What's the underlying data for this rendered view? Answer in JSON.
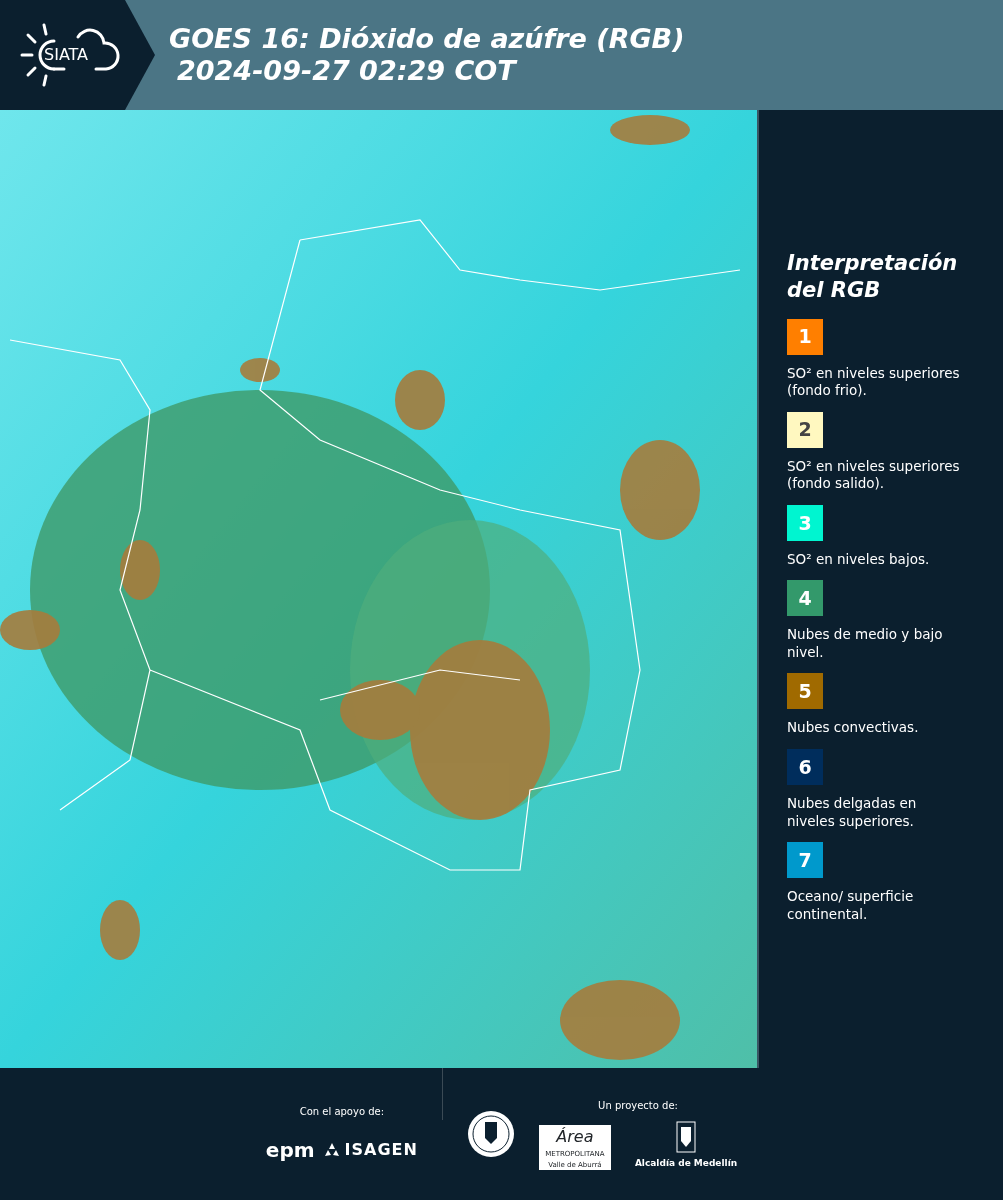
{
  "header": {
    "logo_text": "SIATA",
    "title": "GOES 16: Dióxido de azúfre (RGB)",
    "timestamp": "2024-09-27 02:29 COT"
  },
  "legend": {
    "title_lines": [
      "Interpretación",
      "del RGB"
    ],
    "items": [
      {
        "number": "1",
        "color": "#ff7f00",
        "text": "SO² en niveles superiores (fondo frio)."
      },
      {
        "number": "2",
        "color": "#fff8c0",
        "text": "SO² en niveles superiores (fondo salido)."
      },
      {
        "number": "3",
        "color": "#00f5d0",
        "text": "SO² en niveles bajos."
      },
      {
        "number": "4",
        "color": "#33996b",
        "text": "Nubes de medio y bajo nivel."
      },
      {
        "number": "5",
        "color": "#a06a00",
        "text": "Nubes convectivas."
      },
      {
        "number": "6",
        "color": "#002d5c",
        "text": "Nubes delgadas en niveles superiores."
      },
      {
        "number": "7",
        "color": "#0099cc",
        "text": "Oceano/ superficie continental."
      }
    ]
  },
  "footer": {
    "support_label": "Con el apoyo de:",
    "support_logos": [
      "epm",
      "ISAGEN"
    ],
    "project_label": "Un proyecto de:",
    "area_logo": [
      "Área",
      "METROPOLITANA",
      "Valle de Aburrá"
    ],
    "alcaldia": "Alcaldía de Medellín"
  }
}
